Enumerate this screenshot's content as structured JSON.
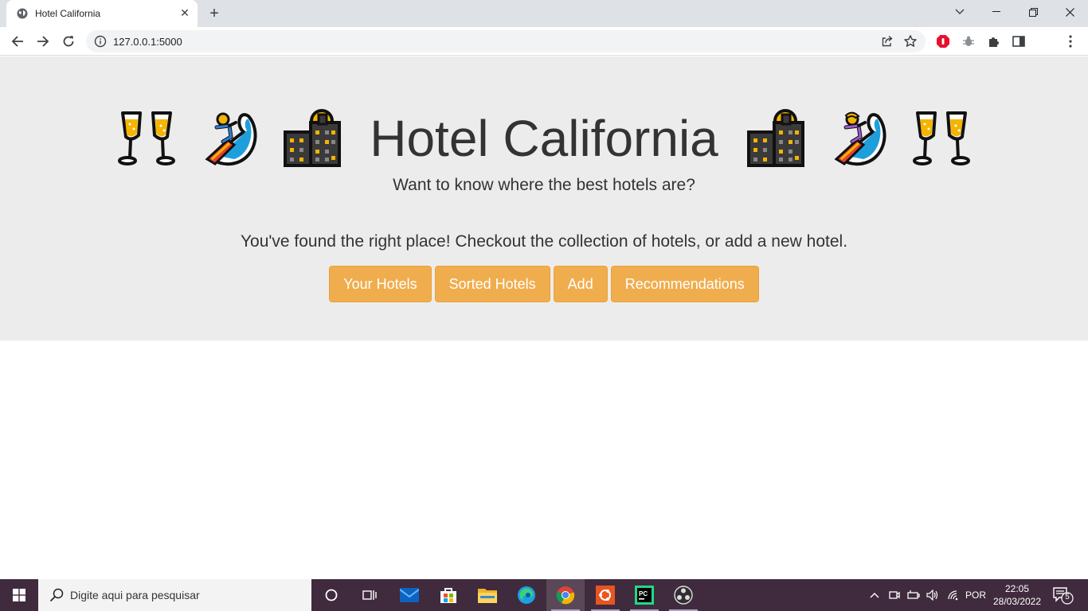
{
  "browser": {
    "tab_title": "Hotel California",
    "tab_close": "✕",
    "new_tab": "+",
    "url": "127.0.0.1:5000"
  },
  "page": {
    "title": "Hotel California",
    "subtitle": "Want to know where the best hotels are?",
    "lead": "You've found the right place! Checkout the collection of hotels, or add a new hotel.",
    "buttons": {
      "your_hotels": "Your Hotels",
      "sorted_hotels": "Sorted Hotels",
      "add": "Add",
      "recommendations": "Recommendations"
    },
    "emoji_row": [
      "clinking-glasses-icon",
      "surfer-icon",
      "city-night-icon",
      "city-night-icon",
      "woman-surfer-icon",
      "clinking-glasses-icon"
    ],
    "accent_color": "#f0ad4e",
    "jumbotron_color": "#ececec"
  },
  "taskbar": {
    "search_placeholder": "Digite aqui para pesquisar",
    "language": "POR",
    "time": "22:05",
    "date": "28/03/2022",
    "notification_count": "5"
  }
}
